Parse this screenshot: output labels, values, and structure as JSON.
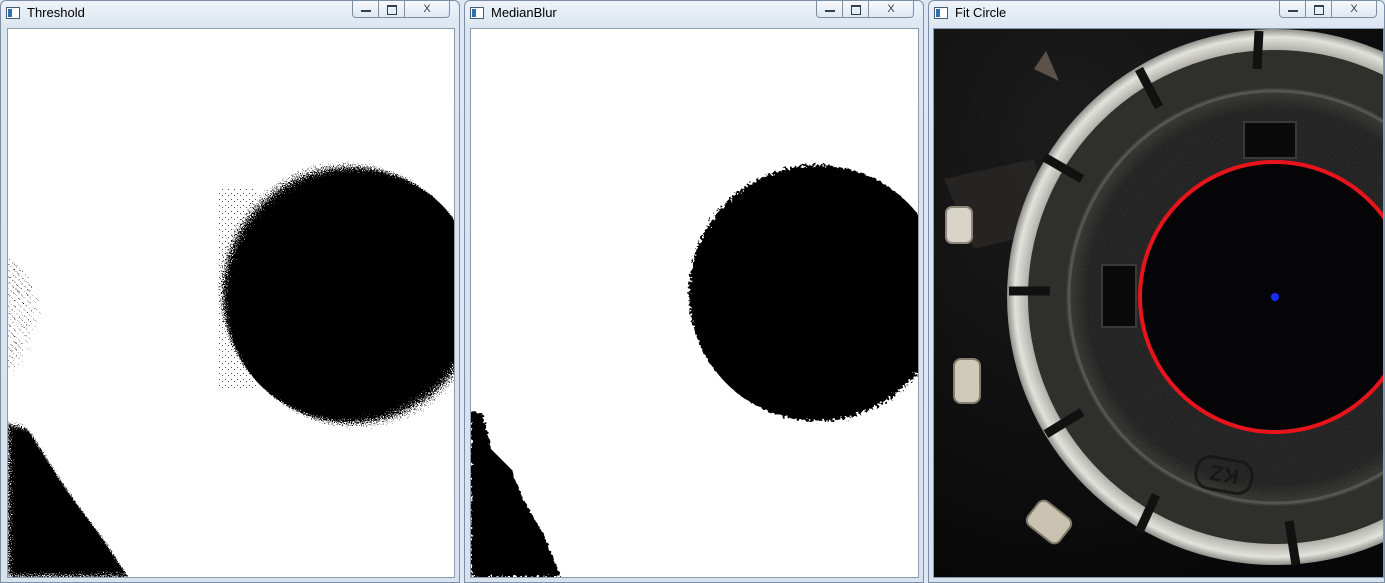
{
  "windows": [
    {
      "title": "Threshold",
      "close_glyph": "X"
    },
    {
      "title": "MedianBlur",
      "close_glyph": "X"
    },
    {
      "title": "Fit Circle",
      "close_glyph": "X"
    }
  ],
  "colors": {
    "binary_black": "#000000",
    "binary_white": "#ffffff",
    "fit_circle": "#e8141c",
    "center_point": "#1a2cff"
  },
  "images": {
    "fit_circle_label": "KZ"
  }
}
